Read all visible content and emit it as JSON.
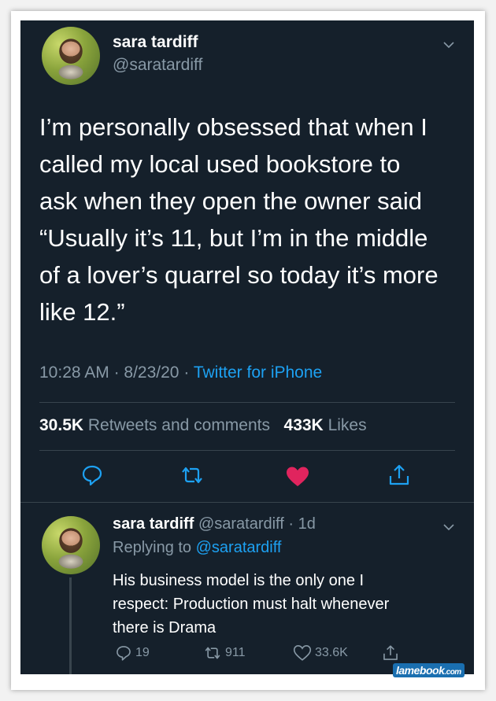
{
  "tweet": {
    "author_name": "sara tardiff",
    "author_handle": "@saratardiff",
    "text": "I’m personally obsessed that when I\ncalled my local used bookstore to\nask when they open the owner said\n“Usually it’s 11, but I’m in the middle\nof a lover’s quarrel so today it’s more\nlike 12.”",
    "time": "10:28 AM",
    "date": "8/23/20",
    "separator": "·",
    "source": "Twitter for iPhone",
    "retweets_count": "30.5K",
    "retweets_label": "Retweets and comments",
    "likes_count": "433K",
    "likes_label": "Likes"
  },
  "reply": {
    "author_name": "sara tardiff",
    "author_handle": "@saratardiff",
    "age": "· 1d",
    "replying_prefix": "Replying to",
    "replying_handle": "@saratardiff",
    "text": "His business model is the only one I\nrespect: Production must halt whenever\nthere is Drama",
    "reply_count": "19",
    "retweet_count": "911",
    "like_count": "33.6K"
  },
  "watermark": {
    "brand": "lamebook",
    "suffix": ".com"
  },
  "icons": {
    "reply": "reply-icon",
    "retweet": "retweet-icon",
    "like": "heart-icon",
    "share": "share-icon",
    "menu": "chevron-down-icon"
  },
  "colors": {
    "background": "#15202b",
    "text": "#ffffff",
    "muted": "#8899a6",
    "link": "#1da1f2",
    "like": "#e0245e",
    "divider": "#38444d"
  }
}
